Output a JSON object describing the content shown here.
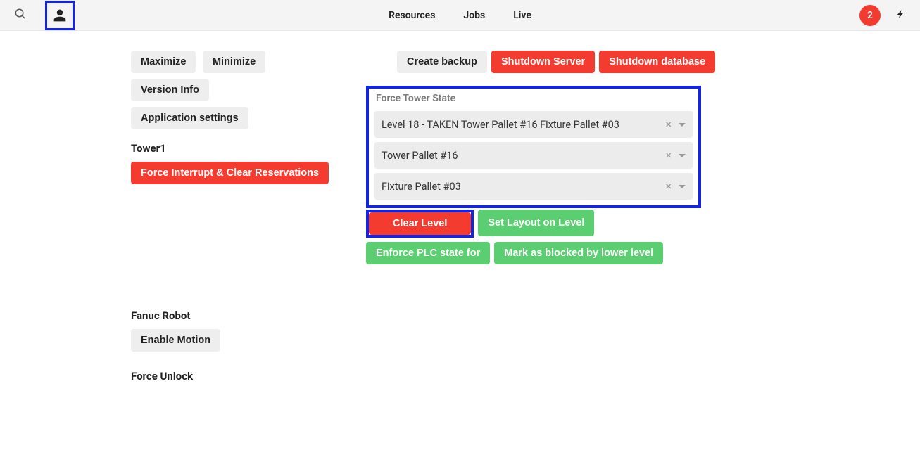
{
  "nav": {
    "resources": "Resources",
    "jobs": "Jobs",
    "live": "Live",
    "notification_count": "2"
  },
  "left_toolbar": {
    "maximize": "Maximize",
    "minimize": "Minimize",
    "version_info": "Version Info",
    "app_settings": "Application settings"
  },
  "right_toolbar": {
    "create_backup": "Create backup",
    "shutdown_server": "Shutdown Server",
    "shutdown_database": "Shutdown database"
  },
  "tower": {
    "title": "Tower1",
    "force_interrupt": "Force Interrupt & Clear Reservations"
  },
  "panel": {
    "title": "Force Tower State",
    "level_select": "Level 18 - TAKEN Tower Pallet #16 Fixture Pallet #03",
    "tower_pallet": "Tower Pallet #16",
    "fixture_pallet": "Fixture Pallet #03"
  },
  "actions": {
    "clear_level": "Clear Level",
    "set_layout": "Set Layout on Level",
    "enforce_plc": "Enforce PLC state for",
    "mark_blocked": "Mark as blocked by lower level"
  },
  "robot": {
    "title": "Fanuc Robot",
    "enable_motion": "Enable Motion"
  },
  "force_unlock": {
    "title": "Force Unlock"
  }
}
